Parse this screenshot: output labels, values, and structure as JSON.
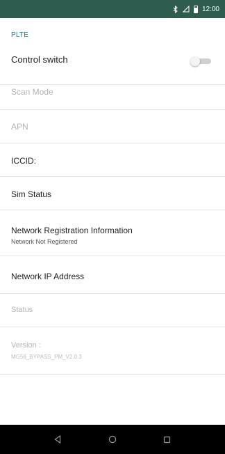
{
  "status_bar": {
    "time": "12:00",
    "bg_color": "#2e5c4f",
    "icons": [
      "bluetooth-icon",
      "signal-icon",
      "battery-icon"
    ]
  },
  "section": {
    "title": "PLTE"
  },
  "rows": {
    "control_switch": {
      "title": "Control switch",
      "enabled": false
    },
    "scan_mode": {
      "title": "Scan Mode",
      "disabled": true
    },
    "apn": {
      "title": "APN",
      "disabled": true
    },
    "iccid": {
      "title": "ICCID:"
    },
    "sim_status": {
      "title": "Sim Status"
    },
    "network_registration": {
      "title": "Network Registration Information",
      "summary": "Network Not Registered"
    },
    "network_ip": {
      "title": "Network IP Address"
    },
    "status": {
      "title": "Status",
      "disabled": true
    },
    "version": {
      "title": "Version :",
      "summary": "MG56_BYPASS_PM_V2.0.3",
      "disabled": true
    }
  },
  "nav_bar": {
    "buttons": [
      "back-icon",
      "home-icon",
      "recents-icon"
    ]
  },
  "colors": {
    "accent": "#2a7d83",
    "nav_bg": "#000000"
  }
}
